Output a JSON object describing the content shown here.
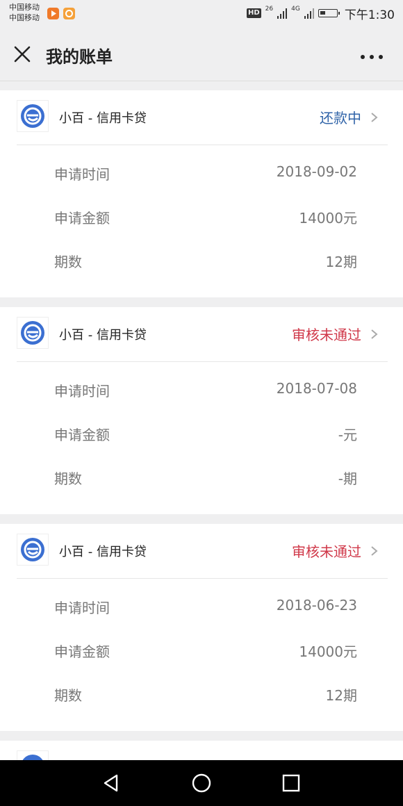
{
  "status_bar": {
    "carrier1": "中国移动",
    "carrier2": "中国移动",
    "hd": "HD",
    "net1": "26",
    "net2": "4G",
    "time": "下午1:30"
  },
  "header": {
    "title": "我的账单"
  },
  "bills": [
    {
      "product": "小百 - 信用卡贷",
      "status": "还款中",
      "status_color": "#2f63a8",
      "rows": [
        {
          "label": "申请时间",
          "value": "2018-09-02"
        },
        {
          "label": "申请金额",
          "value": "14000元"
        },
        {
          "label": "期数",
          "value": "12期"
        }
      ]
    },
    {
      "product": "小百 - 信用卡贷",
      "status": "审核未通过",
      "status_color": "#d0394a",
      "rows": [
        {
          "label": "申请时间",
          "value": "2018-07-08"
        },
        {
          "label": "申请金额",
          "value": "-元"
        },
        {
          "label": "期数",
          "value": "-期"
        }
      ]
    },
    {
      "product": "小百 - 信用卡贷",
      "status": "审核未通过",
      "status_color": "#d0394a",
      "rows": [
        {
          "label": "申请时间",
          "value": "2018-06-23"
        },
        {
          "label": "申请金额",
          "value": "14000元"
        },
        {
          "label": "期数",
          "value": "12期"
        }
      ]
    }
  ],
  "icons": {
    "close": "close-icon",
    "more": "more-dots-icon",
    "logo": "xiaobai-logo-icon",
    "chevron": "chevron-right-icon",
    "nav_back": "back-triangle-icon",
    "nav_home": "home-circle-icon",
    "nav_recent": "recent-apps-square-icon"
  }
}
